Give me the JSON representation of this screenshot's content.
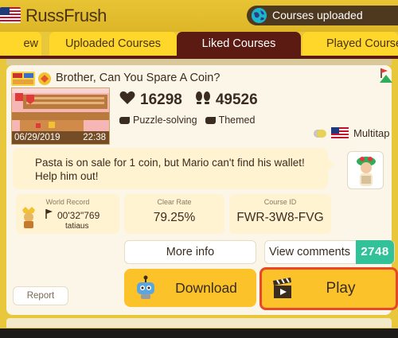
{
  "header": {
    "username": "RussFrush",
    "courses_uploaded_label": "Courses uploaded",
    "flag_icon": "us-flag-icon",
    "globe_icon": "globe-icon"
  },
  "tabs": [
    {
      "label": "ew"
    },
    {
      "label": "Uploaded Courses"
    },
    {
      "label": "Liked Courses"
    },
    {
      "label": "Played Course"
    }
  ],
  "course": {
    "title": "Brother, Can You Spare A Coin?",
    "thumbnail_date": "06/29/2019",
    "thumbnail_time": "22:38",
    "likes": "16298",
    "plays": "49526",
    "tags": [
      "Puzzle-solving",
      "Themed"
    ],
    "multitap_label": "Multitap",
    "description": "Pasta is on sale for 1 coin, but Mario can't find his wallet! Help him out!",
    "world_record": {
      "label": "World Record",
      "time": "00'32\"769",
      "holder": "tatiaus"
    },
    "clear_rate": {
      "label": "Clear Rate",
      "value": "79.25%"
    },
    "course_id": {
      "label": "Course ID",
      "value": "FWR-3W8-FVG"
    }
  },
  "buttons": {
    "more_info": "More info",
    "view_comments": "View comments",
    "comments_count": "2748",
    "download": "Download",
    "play": "Play",
    "report": "Report"
  },
  "colors": {
    "header_bg": "#e8c434",
    "active_tab": "#5c1b12",
    "inactive_tab": "#ffd72a",
    "card_bg": "#fbf6e8",
    "button_yellow": "#fbc22a",
    "comments_green": "#32c29a",
    "play_border": "#e8472a"
  }
}
